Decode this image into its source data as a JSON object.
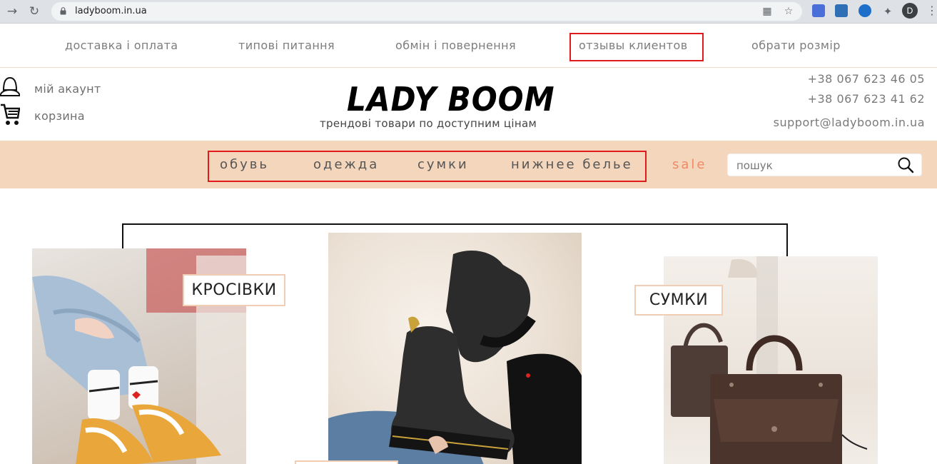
{
  "browser": {
    "url": "ladyboom.in.ua",
    "profile_initial": "D"
  },
  "top_menu": {
    "items": [
      {
        "label": "доставка і оплата"
      },
      {
        "label": "типові питання"
      },
      {
        "label": "обмін і повернення"
      },
      {
        "label": "отзывы клиентов"
      },
      {
        "label": "обрати розмір"
      }
    ]
  },
  "header": {
    "account_label": "мій акаунт",
    "cart_label": "корзина",
    "logo": "LADY BOOM",
    "tagline": "трендові товари по доступним цінам",
    "phone_1": "+38 067 623 46 05",
    "phone_2": "+38 067 623 41 62",
    "email": "support@ladyboom.in.ua"
  },
  "categories": {
    "items": [
      {
        "label": "обувь"
      },
      {
        "label": "одежда"
      },
      {
        "label": "сумки"
      },
      {
        "label": "нижнее белье"
      }
    ],
    "sale_label": "sale",
    "sale_color": "#f08a64"
  },
  "search": {
    "placeholder": "пошук",
    "icon": "search-icon"
  },
  "promo": {
    "sneakers_label": "КРОСІВКИ",
    "bags_label": "СУМКИ"
  },
  "colors": {
    "category_bar": "#f3d6bc",
    "highlight": "#e01b1b",
    "card_border": "#f0cdb3"
  }
}
